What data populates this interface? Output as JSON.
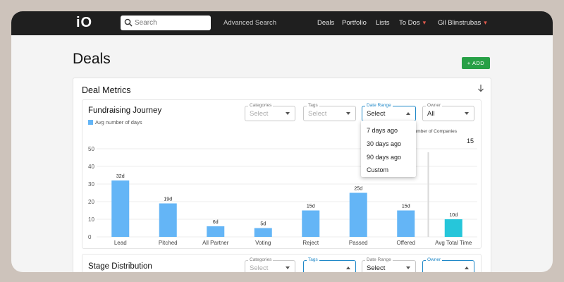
{
  "app": {
    "logo": "iO"
  },
  "header": {
    "search_placeholder": "Search",
    "advanced_search": "Advanced Search",
    "nav": [
      "Deals",
      "Portfolio",
      "Lists",
      "To Dos",
      "Gil Blinstrubas"
    ]
  },
  "page": {
    "title": "Deals",
    "add_label": "+ ADD"
  },
  "deal_metrics": {
    "title": "Deal Metrics",
    "fundraising": {
      "title": "Fundraising Journey",
      "legend": "Avg number of days",
      "filters": {
        "categories": {
          "label": "Categories",
          "value": "Select"
        },
        "tags": {
          "label": "Tags",
          "value": "Select"
        },
        "date_range": {
          "label": "Date Range",
          "value": "Select"
        },
        "owner": {
          "label": "Owner",
          "value": "All"
        }
      },
      "date_options": [
        "7 days ago",
        "30 days ago",
        "90 days ago",
        "Custom"
      ],
      "num_companies_label": "Number of Companies",
      "num_companies_value": "15"
    },
    "stage_distribution": {
      "title": "Stage Distribution",
      "filters": {
        "categories": {
          "label": "Categories",
          "value": "Select"
        },
        "tags": {
          "label": "Tags",
          "value": ""
        },
        "date_range": {
          "label": "Date Range",
          "value": "Select"
        },
        "owner": {
          "label": "Owner",
          "value": ""
        }
      }
    }
  },
  "chart_data": {
    "type": "bar",
    "categories": [
      "Lead",
      "Pitched",
      "All Partner",
      "Voting",
      "Reject",
      "Passed",
      "Offered",
      "Avg Total Time"
    ],
    "values": [
      32,
      19,
      6,
      5,
      15,
      25,
      15,
      10
    ],
    "data_labels": [
      "32d",
      "19d",
      "6d",
      "5d",
      "15d",
      "25d",
      "15d",
      "10d"
    ],
    "yticks": [
      0,
      10,
      20,
      30,
      40,
      50
    ],
    "ylim": [
      0,
      50
    ],
    "legend": "Avg number of days",
    "colors": {
      "bar": "#64b5f6",
      "total": "#26c6da"
    },
    "grid": true
  }
}
